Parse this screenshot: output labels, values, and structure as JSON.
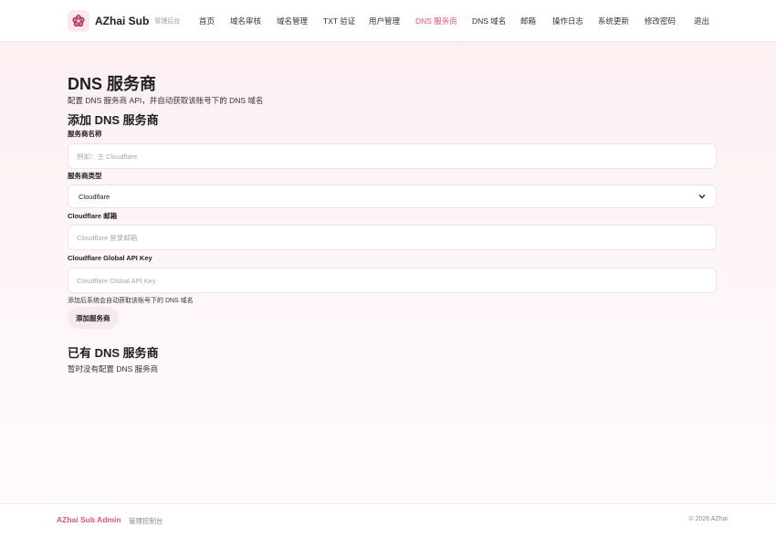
{
  "header": {
    "brand_name": "AZhai Sub",
    "brand_sub": "管理后台",
    "logo_icon": "sakura-flower-icon",
    "accent_color": "#e0557a",
    "nav": [
      {
        "label": "首页",
        "active": false
      },
      {
        "label": "域名审核",
        "active": false
      },
      {
        "label": "域名管理",
        "active": false
      },
      {
        "label": "TXT 验证",
        "active": false
      },
      {
        "label": "用户管理",
        "active": false
      },
      {
        "label": "DNS 服务商",
        "active": true
      },
      {
        "label": "DNS 域名",
        "active": false
      },
      {
        "label": "邮箱",
        "active": false
      },
      {
        "label": "操作日志",
        "active": false
      },
      {
        "label": "系统更新",
        "active": false
      },
      {
        "label": "修改密码",
        "active": false
      },
      {
        "label": "退出",
        "active": false
      }
    ]
  },
  "page": {
    "title": "DNS 服务商",
    "description": "配置 DNS 服务商 API，并自动获取该账号下的 DNS 域名"
  },
  "add_form": {
    "title": "添加 DNS 服务商",
    "name_label": "服务商名称",
    "name_placeholder": "例如：主 Cloudflare",
    "name_value": "",
    "type_label": "服务商类型",
    "type_selected": "Cloudflare",
    "email_label": "Cloudflare 邮箱",
    "email_placeholder": "Cloudflare 登录邮箱",
    "email_value": "",
    "apikey_label": "Cloudflare Global API Key",
    "apikey_placeholder": "Cloudflare Global API Key",
    "apikey_value": "",
    "hint": "添加后系统会自动获取该账号下的 DNS 域名",
    "submit_label": "添加服务商"
  },
  "existing": {
    "title": "已有 DNS 服务商",
    "empty_text": "暂时没有配置 DNS 服务商"
  },
  "footer": {
    "brand": "AZhai Sub Admin",
    "sub": "管理控制台",
    "copyright": "© 2026 AZhai"
  }
}
